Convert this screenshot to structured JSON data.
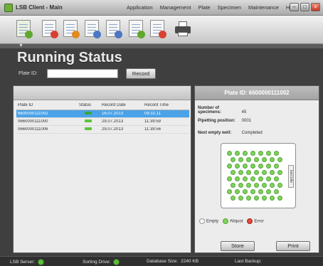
{
  "window": {
    "title": "LSB Client - Main",
    "menu": [
      "Application",
      "Management",
      "Plate",
      "Specimen",
      "Maintenance",
      "Help"
    ]
  },
  "toolbar": {
    "tools": [
      "new-icon",
      "report-icon",
      "warning-report-icon",
      "list-icon",
      "list-edit-icon",
      "list-add-icon",
      "list-remove-icon",
      "printer-icon"
    ]
  },
  "page": {
    "title": "Running Status",
    "plate_label": "Plate ID:",
    "plate_input_value": "",
    "record_button": "Record"
  },
  "table": {
    "headers": [
      "Plate ID",
      "Status",
      "Record Date",
      "Record Time"
    ],
    "rows": [
      {
        "plate_id": "6600000111002",
        "date": "16.07.2013",
        "time": "09:31:11"
      },
      {
        "plate_id": "0660000111000",
        "date": "29.07.2013",
        "time": "11:39:59"
      },
      {
        "plate_id": "0660000111006",
        "date": "29.07.2013",
        "time": "11:39:56"
      }
    ]
  },
  "detail": {
    "header": "Plate ID: 6600000111002",
    "num_specimens_label": "Number of specimens:",
    "num_specimens_value": "45",
    "pipetting_label": "Pipetting position:",
    "pipetting_value": "0001",
    "next_well_label": "Next empty well:",
    "next_well_value": "Completed",
    "plate_side_label": "barcode",
    "legend": {
      "empty": "Empty",
      "aliquot": "Aliquot",
      "error": "Error"
    },
    "store_button": "Store",
    "print_button": "Print"
  },
  "status": {
    "server_label": "LSB Server:",
    "sorting_label": "Sorting Drive:",
    "db_label": "Database Size:",
    "db_value": "2240 KB",
    "backup_label": "Last Backup:"
  },
  "colors": {
    "selected_row": "#4aa3e8",
    "well_green": "#7fd15a",
    "status_green": "#5cbf3a"
  }
}
